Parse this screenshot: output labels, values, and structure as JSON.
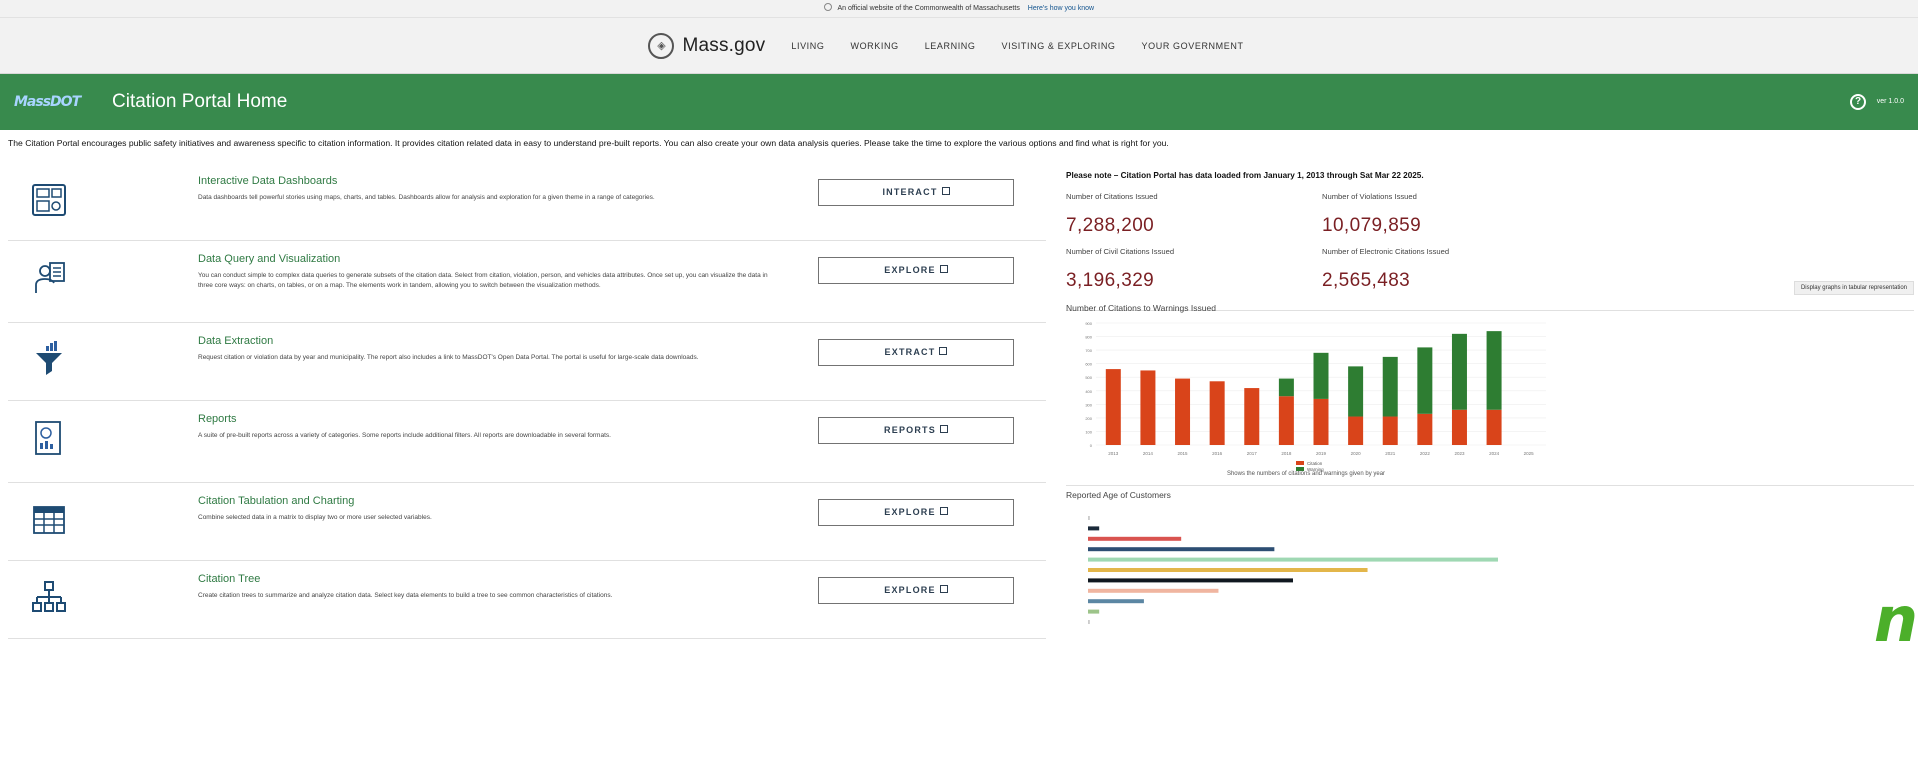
{
  "banner": {
    "official_text": "An official website of the Commonwealth of Massachusetts",
    "how_link": "Here's how you know"
  },
  "massnav": {
    "brand": "Mass.gov",
    "links": [
      "LIVING",
      "WORKING",
      "LEARNING",
      "VISITING & EXPLORING",
      "YOUR GOVERNMENT"
    ]
  },
  "appbar": {
    "logo_text": "MassDOT",
    "title": "Citation Portal Home",
    "version": "ver 1.0.0"
  },
  "intro": "The Citation Portal encourages public safety initiatives and awareness specific to citation information. It provides citation related data in easy to understand pre-built reports. You can also create your own data analysis queries. Please take the time to explore the various options and find what is right for you.",
  "tools": [
    {
      "title": "Interactive Data Dashboards",
      "desc": "Data dashboards tell powerful stories using maps, charts, and tables. Dashboards allow for analysis and exploration for a given theme in a range of categories.",
      "button": "INTERACT",
      "icon": "dashboard-icon"
    },
    {
      "title": "Data Query and Visualization",
      "desc": "You can conduct simple to complex data queries to generate subsets of the citation data. Select from citation, violation, person, and vehicles data attributes. Once set up, you can visualize the data in three core ways: on charts, on tables, or on a map. The elements work in tandem, allowing you to switch between the visualization methods.",
      "button": "EXPLORE",
      "icon": "query-icon"
    },
    {
      "title": "Data Extraction",
      "desc": "Request citation or violation data by year and municipality. The report also includes a link to MassDOT's Open Data Portal. The portal is useful for large-scale data downloads.",
      "button": "EXTRACT",
      "icon": "funnel-icon"
    },
    {
      "title": "Reports",
      "desc": "A suite of pre-built reports across a variety of categories. Some reports include additional filters. All reports are downloadable in several formats.",
      "button": "REPORTS",
      "icon": "report-icon"
    },
    {
      "title": "Citation Tabulation and Charting",
      "desc": "Combine selected data in a matrix to display two or more user selected variables.",
      "button": "EXPLORE",
      "icon": "table-icon"
    },
    {
      "title": "Citation Tree",
      "desc": "Create citation trees to summarize and analyze citation data. Select key data elements to build a tree to see common characteristics of citations.",
      "button": "EXPLORE",
      "icon": "tree-icon"
    }
  ],
  "right": {
    "note": "Please note – Citation Portal has data loaded from January 1, 2013 through Sat Mar 22 2025.",
    "stats": [
      {
        "label": "Number of Citations Issued",
        "value": "7,288,200"
      },
      {
        "label": "Number of Violations Issued",
        "value": "10,079,859"
      },
      {
        "label": "Number of Civil Citations Issued",
        "value": "3,196,329"
      },
      {
        "label": "Number of Electronic Citations Issued",
        "value": "2,565,483"
      }
    ],
    "table_button": "Display graphs in tabular representation",
    "chart_caption": "Shows the numbers of citations and warnings given by year",
    "age_title": "Reported Age of Customers",
    "colors": {
      "citation": "#d9441a",
      "warning": "#2e7d32",
      "stat_value": "#7a1f23"
    }
  },
  "chart_data": [
    {
      "type": "bar",
      "title": "Number of Citations to Warnings Issued",
      "categories": [
        "2013",
        "2014",
        "2015",
        "2016",
        "2017",
        "2018",
        "2019",
        "2020",
        "2021",
        "2022",
        "2023",
        "2024",
        "2025"
      ],
      "series": [
        {
          "name": "Citation",
          "values": [
            560,
            550,
            490,
            470,
            420,
            360,
            340,
            210,
            210,
            230,
            260,
            260,
            0
          ]
        },
        {
          "name": "Warning",
          "values": [
            0,
            0,
            0,
            0,
            0,
            130,
            340,
            370,
            440,
            490,
            560,
            580,
            0
          ]
        }
      ],
      "stacked": true,
      "ylim": [
        0,
        900
      ]
    },
    {
      "type": "bar",
      "orientation": "horizontal",
      "title": "Reported Age of Customers",
      "values": [
        1,
        6,
        50,
        100,
        220,
        150,
        110,
        70,
        30,
        6,
        1
      ],
      "colors": [
        "#cccccc",
        "#1a2a3a",
        "#d9534f",
        "#2d4e73",
        "#9fd8b3",
        "#e3b64a",
        "#101820",
        "#f0b5a0",
        "#5b86a3",
        "#9dc48a",
        "#cccccc"
      ]
    }
  ]
}
